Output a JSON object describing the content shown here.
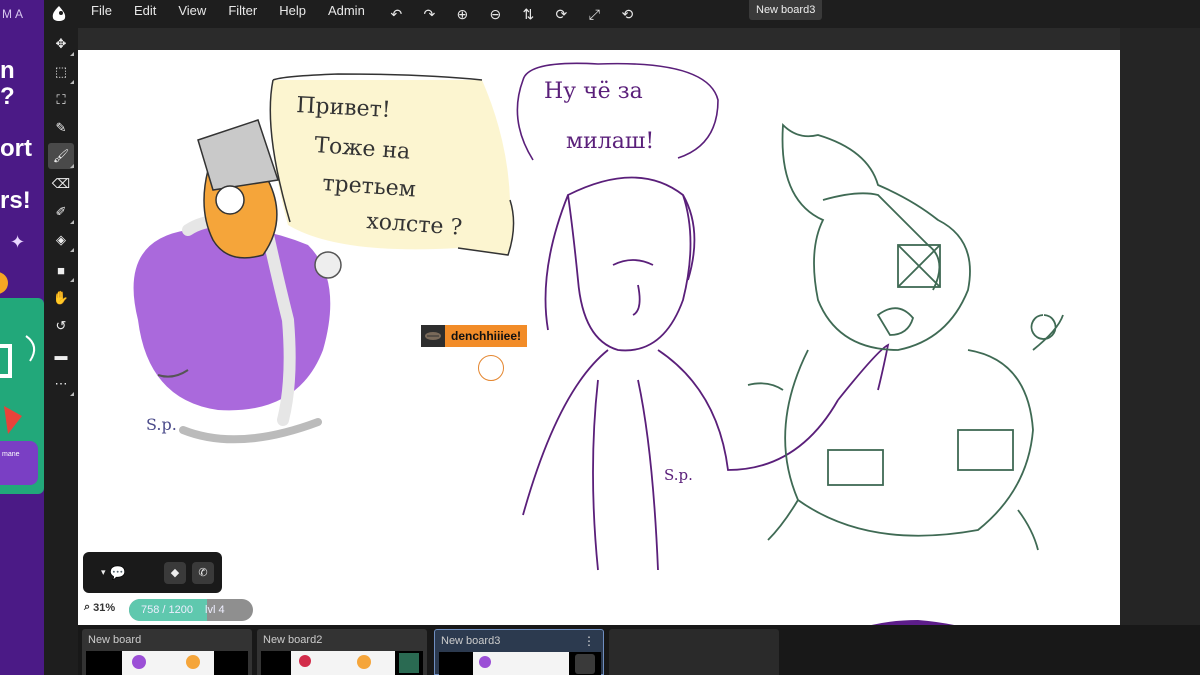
{
  "ad": {
    "brand": "MA",
    "lines": [
      "n",
      "?",
      "ort",
      "rs!"
    ],
    "tag": "mane"
  },
  "menubar": {
    "items": [
      "File",
      "Edit",
      "View",
      "Filter",
      "Help",
      "Admin"
    ],
    "icons": [
      "undo-icon",
      "redo-icon",
      "zoom-in-icon",
      "zoom-out-icon",
      "flip-icon",
      "rotate-icon",
      "fullscreen-icon",
      "reset-icon"
    ]
  },
  "current_board": "New board3",
  "toolbar": {
    "tools": [
      "move-icon",
      "select-rect-icon",
      "transform-icon",
      "eyedropper-icon",
      "brush-icon",
      "eraser-icon",
      "smudge-icon",
      "fill-icon",
      "shape-icon",
      "hand-icon",
      "rotate-view-icon",
      "comment-icon",
      "more-icon"
    ],
    "active": "brush-icon"
  },
  "cursor_user": {
    "name": "denchhiiiee!"
  },
  "drawing_text": {
    "bubble1": [
      "Привет!",
      "Тоже на",
      "третьем",
      "холсте ?"
    ],
    "bubble2": [
      "Ну чё за",
      "милаш!"
    ],
    "sign1": "S.p.",
    "sign2": "S.p."
  },
  "colors": {
    "accent": "#f28c28",
    "progress_fill": "#5fc8ae",
    "ad_bg": "#4b1a86",
    "ad_green": "#22a87a",
    "purple_ink": "#5a1f7a",
    "green_ink": "#3f6a54"
  },
  "chat": {
    "toggle_icon": "chat-icon",
    "voice_icon": "voice-icon",
    "call_icon": "phone-icon"
  },
  "zoom": {
    "label": "31%"
  },
  "progress": {
    "text": "758 / 1200",
    "level": "lvl 4",
    "value": 758,
    "max": 1200
  },
  "boards": [
    {
      "name": "New board",
      "active": false
    },
    {
      "name": "New board2",
      "active": false
    },
    {
      "name": "New board3",
      "active": true
    }
  ]
}
